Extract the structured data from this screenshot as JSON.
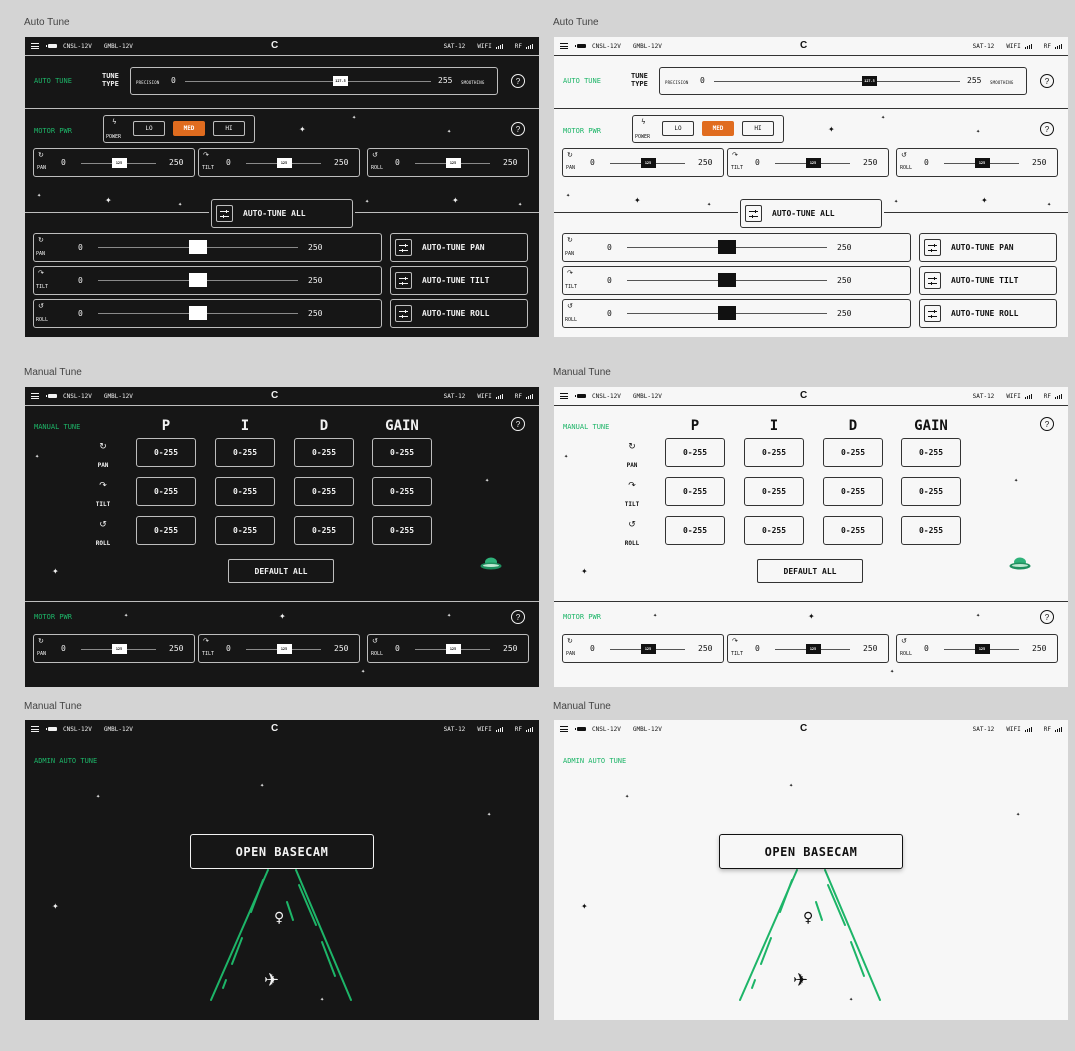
{
  "frames": {
    "auto": "Auto Tune",
    "manual_1": "Manual Tune",
    "manual_2": "Manual Tune"
  },
  "status": {
    "cnsl": "CNSL-12V",
    "gmbl": "GMBL-12V",
    "logo": "C",
    "sat": "SAT-12",
    "wifi": "WIFI",
    "rf": "RF"
  },
  "auto_tune": {
    "label": "AUTO TUNE",
    "tune_type_1": "TUNE",
    "tune_type_2": "TYPE",
    "precision_label": "PRECISION",
    "precision_min": "0",
    "precision_max": "255",
    "precision_value": "127.5",
    "smoothing_label": "SMOOTHING",
    "help": "?"
  },
  "motor_pwr": {
    "label": "MOTOR PWR",
    "power_label": "POWER",
    "lo": "LO",
    "med": "MED",
    "hi": "HI",
    "active": "MED",
    "help": "?",
    "axes": [
      {
        "name": "PAN",
        "min": "0",
        "max": "250",
        "value": "125",
        "level": 0.5
      },
      {
        "name": "TILT",
        "min": "0",
        "max": "250",
        "value": "125",
        "level": 0.5
      },
      {
        "name": "ROLL",
        "min": "0",
        "max": "250",
        "value": "125",
        "level": 0.5
      }
    ]
  },
  "auto_tune_all": "AUTO-TUNE ALL",
  "axis_rows": [
    {
      "name": "PAN",
      "min": "0",
      "max": "250",
      "level": 0.5,
      "button": "AUTO-TUNE PAN"
    },
    {
      "name": "TILT",
      "min": "0",
      "max": "250",
      "level": 0.5,
      "button": "AUTO-TUNE TILT"
    },
    {
      "name": "ROLL",
      "min": "0",
      "max": "250",
      "level": 0.5,
      "button": "AUTO-TUNE ROLL"
    }
  ],
  "manual_tune": {
    "label": "MANUAL TUNE",
    "headers": [
      "P",
      "I",
      "D",
      "GAIN"
    ],
    "rows": [
      {
        "name": "PAN",
        "cells": [
          "0-255",
          "0-255",
          "0-255",
          "0-255"
        ]
      },
      {
        "name": "TILT",
        "cells": [
          "0-255",
          "0-255",
          "0-255",
          "0-255"
        ]
      },
      {
        "name": "ROLL",
        "cells": [
          "0-255",
          "0-255",
          "0-255",
          "0-255"
        ]
      }
    ],
    "default_all": "DEFAULT ALL",
    "help": "?"
  },
  "admin": {
    "label": "ADMIN AUTO TUNE",
    "open_basecam": "OPEN BASECAM"
  },
  "icons": {
    "pan": "pan-rotate-icon",
    "tilt": "tilt-rotate-icon",
    "roll": "roll-rotate-icon",
    "power": "lightning-icon",
    "sliders": "sliders-icon",
    "ufo": "ufo-icon"
  },
  "colors": {
    "accent_green": "#1db568",
    "active_orange": "#e06c1f",
    "dark_bg": "#161616",
    "light_bg": "#f7f7f7"
  }
}
